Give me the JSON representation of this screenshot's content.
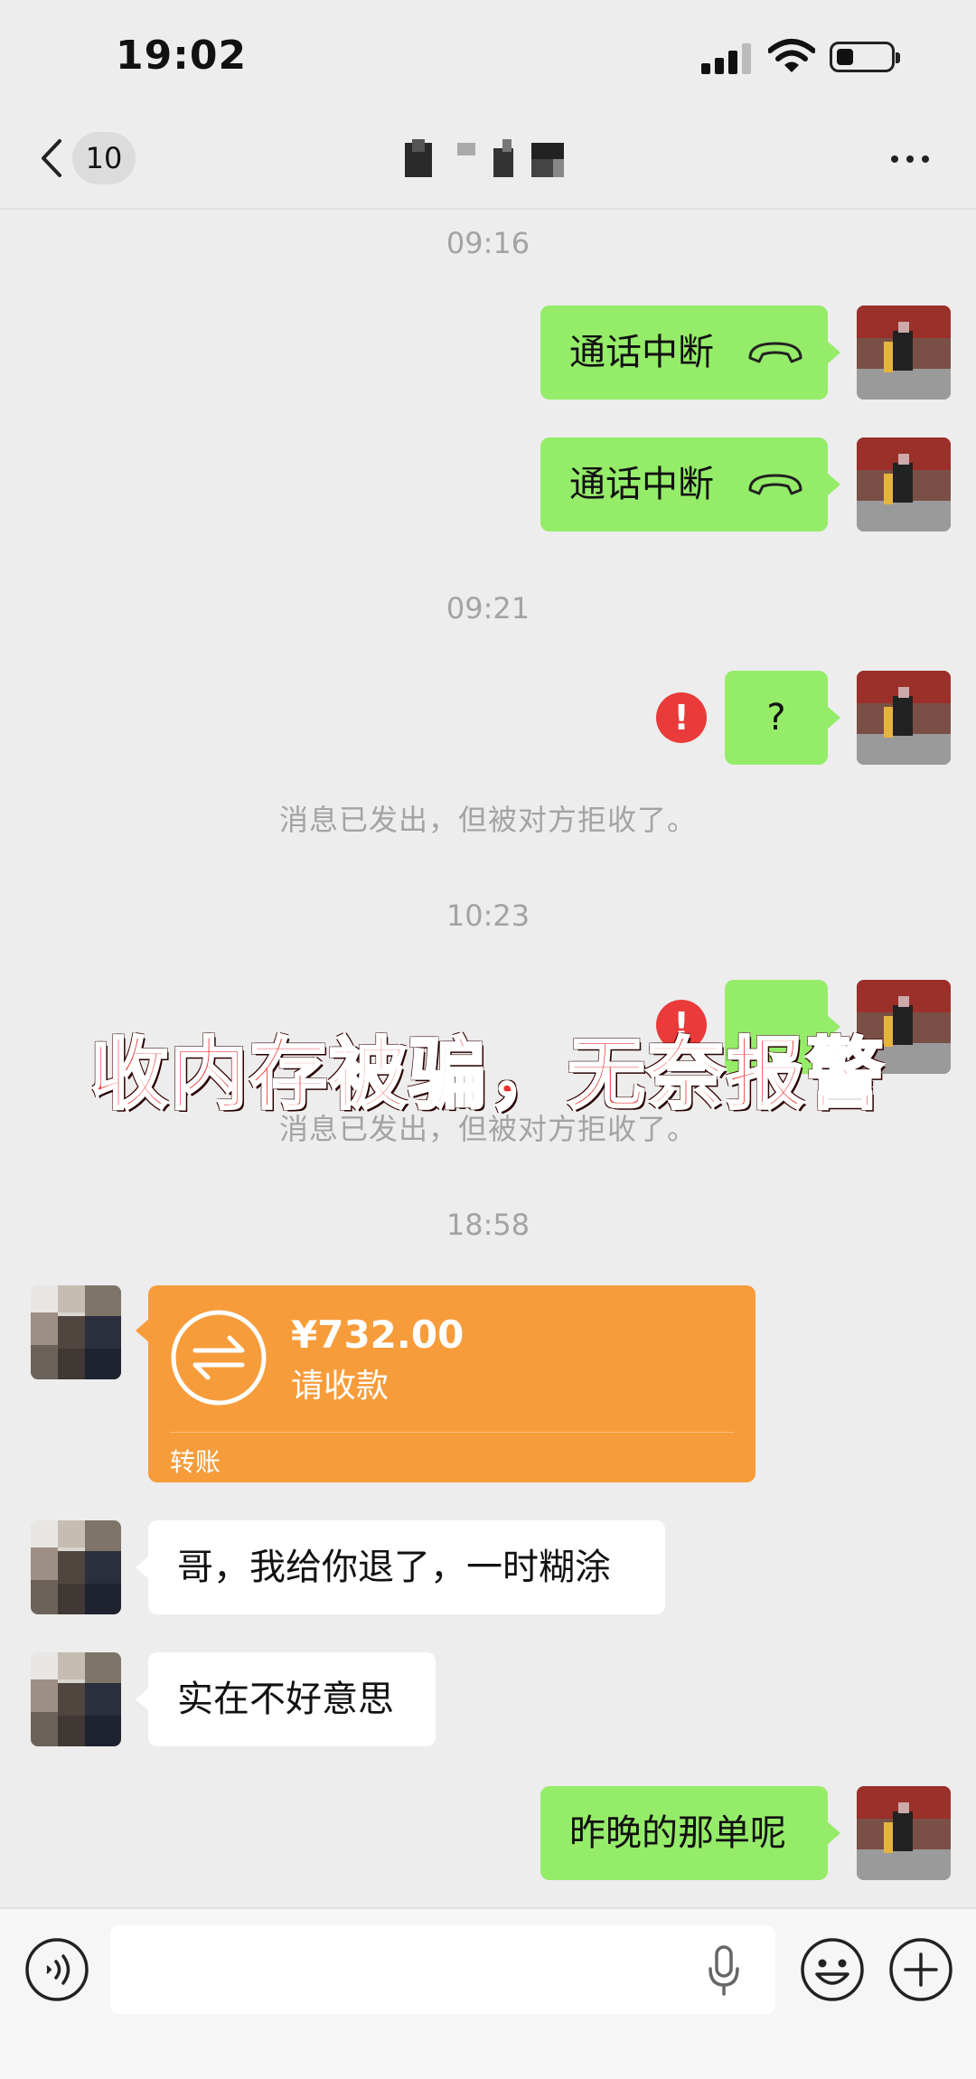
{
  "status_bar": {
    "time": "19:02",
    "icons": [
      "signal-icon",
      "wifi-icon",
      "battery-icon"
    ]
  },
  "nav": {
    "back_icon": "chevron-left-icon",
    "unread_count": "10",
    "more_icon": "more-dots-icon"
  },
  "messages": {
    "ts1": "09:16",
    "call1": "通话中断",
    "call2": "通话中断",
    "ts2": "09:21",
    "q1": "?",
    "rejected1": "消息已发出，但被对方拒收了。",
    "ts3": "10:23",
    "rejected2": "消息已发出，但被对方拒收了。",
    "ts4": "18:58",
    "transfer": {
      "amount": "¥732.00",
      "status": "请收款",
      "label": "转账"
    },
    "them1": "哥，我给你退了，一时糊涂",
    "them2": "实在不好意思",
    "me_last": "昨晚的那单呢"
  },
  "overlay": {
    "caption": "收内存被骗，无奈报警"
  },
  "input_bar": {
    "icons": [
      "voice-icon",
      "microphone-icon",
      "emoji-icon",
      "plus-icon"
    ]
  },
  "colors": {
    "background": "#ededed",
    "my_bubble": "#95ec69",
    "their_bubble": "#ffffff",
    "transfer_card": "#f79c3b",
    "error": "#ea3a3a",
    "caption": "#e8322f"
  }
}
